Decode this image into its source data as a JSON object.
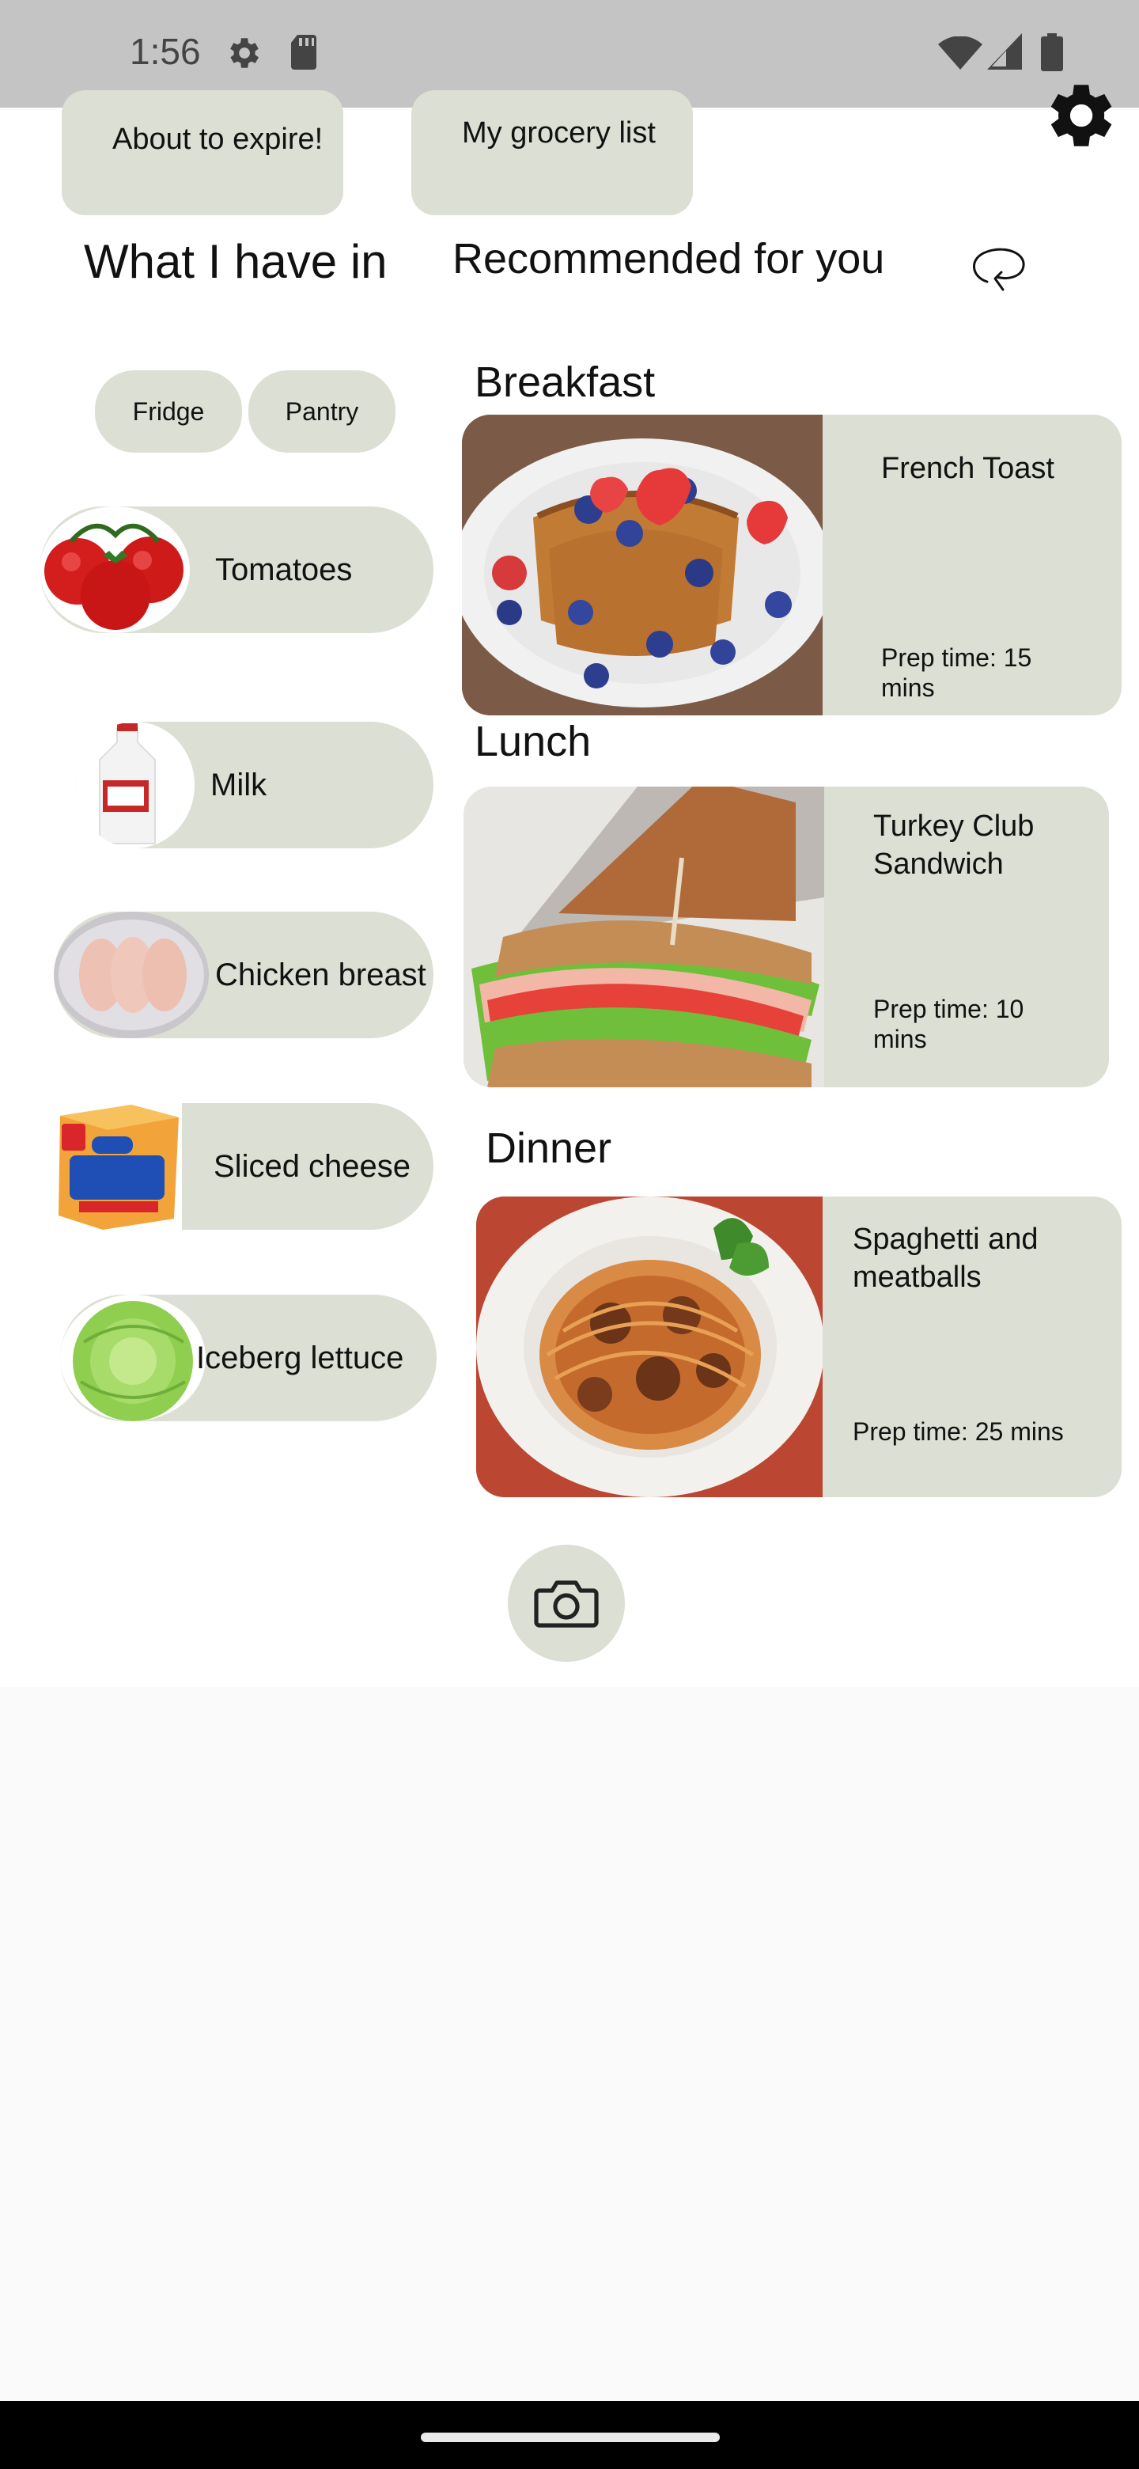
{
  "status_bar": {
    "time": "1:56",
    "icons": [
      "settings-icon",
      "sd-card-icon",
      "wifi-icon",
      "cellular-icon",
      "battery-icon"
    ]
  },
  "top_buttons": {
    "expiring_label": "About to expire!",
    "grocery_label": "My grocery list"
  },
  "settings": {
    "icon": "gear-icon"
  },
  "inventory": {
    "heading": "What I have in",
    "tabs": [
      "Fridge",
      "Pantry"
    ],
    "items": [
      {
        "name": "Tomatoes",
        "image": "tomatoes"
      },
      {
        "name": "Milk",
        "image": "milk-jug"
      },
      {
        "name": "Chicken breast",
        "image": "chicken-breast"
      },
      {
        "name": "Sliced cheese",
        "image": "cheese-singles-pack"
      },
      {
        "name": "Iceberg lettuce",
        "image": "lettuce-head"
      }
    ]
  },
  "recommendations": {
    "heading": "Recommended for you",
    "refresh_icon": "refresh-icon",
    "meals": [
      {
        "section": "Breakfast",
        "title": "French Toast",
        "prep": "Prep time: 15 mins",
        "image": "french-toast-with-berries"
      },
      {
        "section": "Lunch",
        "title": "Turkey Club Sandwich",
        "prep": "Prep time: 10 mins",
        "image": "club-sandwich"
      },
      {
        "section": "Dinner",
        "title": "Spaghetti and meatballs",
        "prep": "Prep time: 25 mins",
        "image": "spaghetti-plate"
      }
    ]
  },
  "camera": {
    "icon": "camera-icon"
  },
  "colors": {
    "pill": "#dcdfd3",
    "status_bar": "#c4c4c4",
    "app_bg": "#ffffff",
    "page_bg": "#fafafa",
    "nav_bar": "#000000"
  }
}
